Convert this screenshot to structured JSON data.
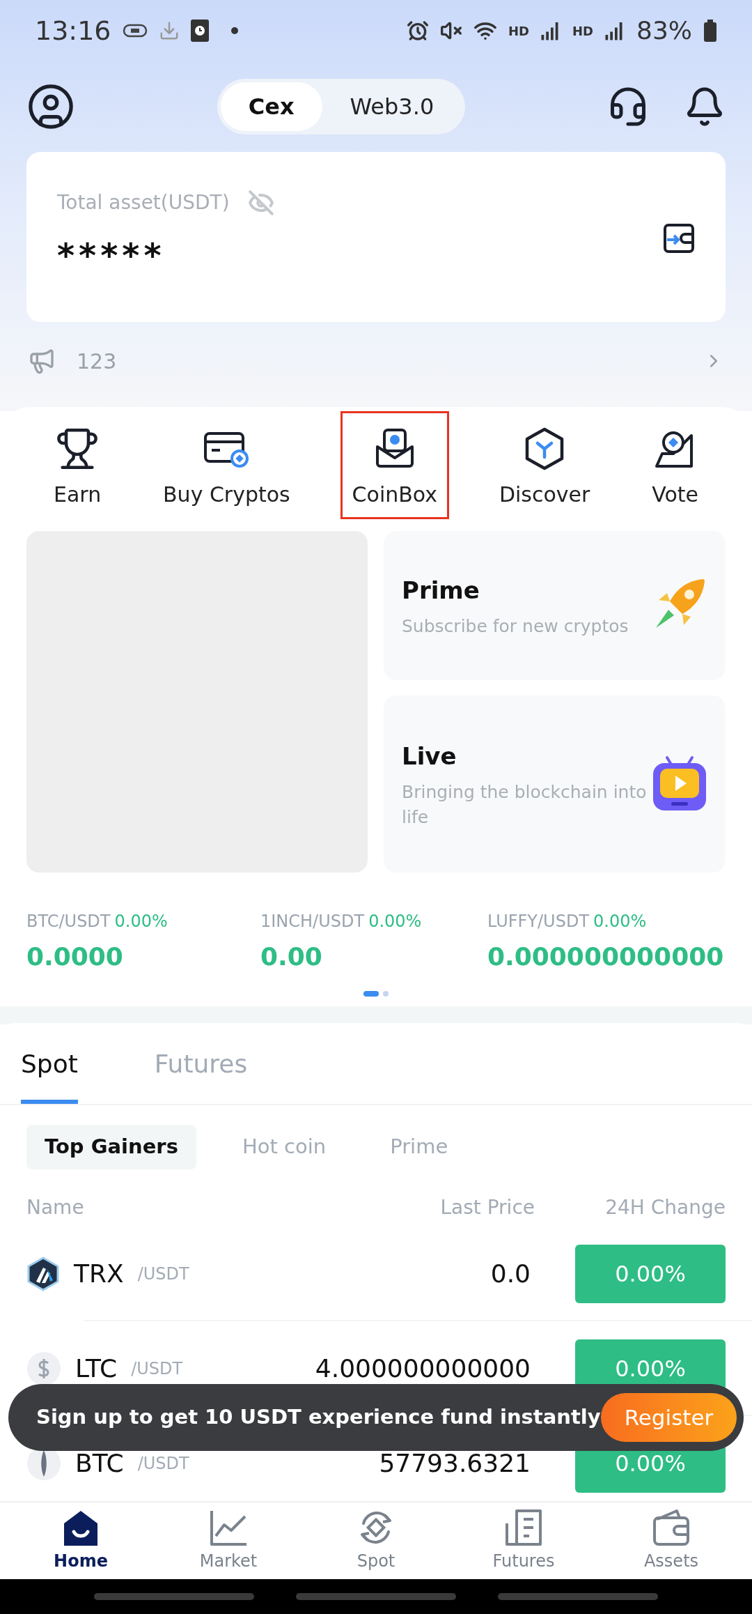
{
  "status_bar": {
    "time": "13:16",
    "network_1": "HD",
    "network_2": "HD",
    "battery": "83%"
  },
  "header": {
    "modes": [
      {
        "label": "Cex",
        "selected": true
      },
      {
        "label": "Web3.0",
        "selected": false
      }
    ]
  },
  "asset_card": {
    "label": "Total asset(USDT)",
    "value": "*****"
  },
  "announcement": {
    "text": "123"
  },
  "shortcuts": [
    {
      "label": "Earn",
      "selected": false
    },
    {
      "label": "Buy Cryptos",
      "selected": false
    },
    {
      "label": "CoinBox",
      "selected": true
    },
    {
      "label": "Discover",
      "selected": false
    },
    {
      "label": "Vote",
      "selected": false
    }
  ],
  "promo_cards": [
    {
      "title": "Prime",
      "subtitle": "Subscribe for new cryptos"
    },
    {
      "title": "Live",
      "subtitle": "Bringing the blockchain into life"
    }
  ],
  "tickers": [
    {
      "pair": "BTC/USDT",
      "change": "0.00%",
      "price": "0.0000"
    },
    {
      "pair": "1INCH/USDT",
      "change": "0.00%",
      "price": "0.00"
    },
    {
      "pair": "LUFFY/USDT",
      "change": "0.00%",
      "price": "0.000000000000"
    }
  ],
  "ticker_pages": [
    {
      "selected": true
    },
    {
      "selected": false
    }
  ],
  "market_tabs": [
    {
      "label": "Spot",
      "selected": true
    },
    {
      "label": "Futures",
      "selected": false
    }
  ],
  "market_filters": [
    {
      "label": "Top Gainers",
      "selected": true
    },
    {
      "label": "Hot coin",
      "selected": false
    },
    {
      "label": "Prime",
      "selected": false
    }
  ],
  "table": {
    "columns": [
      "Name",
      "Last Price",
      "24H Change"
    ],
    "rows": [
      {
        "base": "TRX",
        "quote": "/USDT",
        "price": "0.0",
        "change": "0.00%"
      },
      {
        "base": "LTC",
        "quote": "/USDT",
        "price": "4.000000000000",
        "change": "0.00%"
      },
      {
        "base": "BTC",
        "quote": "/USDT",
        "price": "57793.6321",
        "change": "0.00%"
      }
    ]
  },
  "signup_toast": {
    "text": "Sign up to get 10 USDT experience fund instantly",
    "button": "Register"
  },
  "bottom_nav": [
    {
      "label": "Home",
      "selected": true
    },
    {
      "label": "Market",
      "selected": false
    },
    {
      "label": "Spot",
      "selected": false
    },
    {
      "label": "Futures",
      "selected": false
    },
    {
      "label": "Assets",
      "selected": false
    }
  ]
}
